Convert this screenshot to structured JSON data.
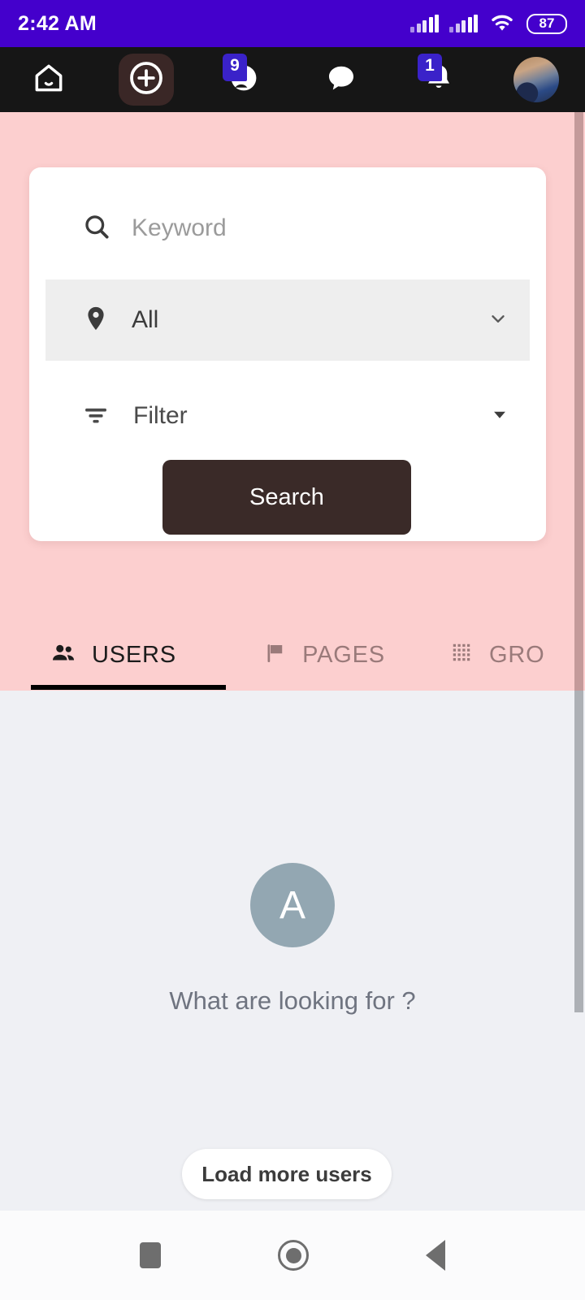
{
  "status_bar": {
    "time": "2:42 AM",
    "battery_level": "87",
    "signal_icon": "signal-bars-icon",
    "wifi_icon": "wifi-icon",
    "background_color": "#4400cc"
  },
  "app_nav": {
    "background_color": "#161616",
    "items": [
      {
        "name": "home",
        "icon": "home-icon",
        "badge": "",
        "active": false
      },
      {
        "name": "create",
        "icon": "plus-circle-icon",
        "badge": "",
        "active": true
      },
      {
        "name": "friends",
        "icon": "friends-icon",
        "badge": "9",
        "active": false
      },
      {
        "name": "messages",
        "icon": "chat-bubble-icon",
        "badge": "",
        "active": false
      },
      {
        "name": "notifications",
        "icon": "bell-icon",
        "badge": "1",
        "active": false
      },
      {
        "name": "profile",
        "icon": "avatar-photo",
        "badge": "",
        "active": false
      }
    ]
  },
  "search_card": {
    "keyword": {
      "value": "",
      "placeholder": "Keyword",
      "icon": "search-icon"
    },
    "location": {
      "value": "All",
      "icon": "location-pin-icon",
      "chevron": "chevron-down-icon"
    },
    "filter": {
      "value": "Filter",
      "icon": "filter-icon",
      "chevron": "caret-down-icon"
    },
    "submit_label": "Search",
    "submit_color": "#3a2a28"
  },
  "tabs": {
    "items": [
      {
        "label": "USERS",
        "icon": "people-icon",
        "active": true
      },
      {
        "label": "PAGES",
        "icon": "flag-icon",
        "active": false
      },
      {
        "label": "GRO",
        "icon": "grid-icon",
        "active": false
      }
    ],
    "header_background": "#fccfcf",
    "active_indicator_color": "#000000"
  },
  "content": {
    "empty_state": {
      "avatar_letter": "A",
      "avatar_color": "#93a7b2",
      "message": "What are looking for ?"
    },
    "load_more_label": "Load more users",
    "background_color": "#eff0f4"
  },
  "android_nav": {
    "recents_icon": "square-icon",
    "home_icon": "circle-icon",
    "back_icon": "triangle-left-icon"
  }
}
